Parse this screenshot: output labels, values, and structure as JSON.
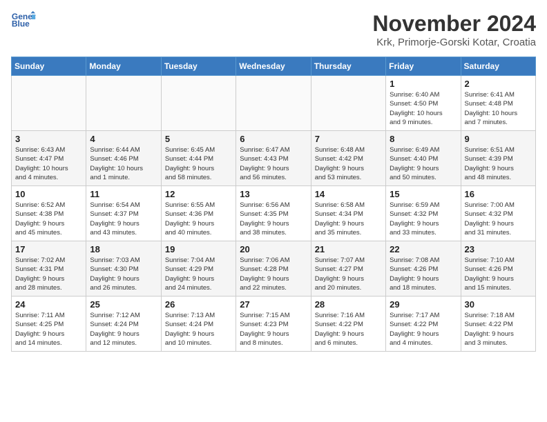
{
  "header": {
    "logo_line1": "General",
    "logo_line2": "Blue",
    "month_year": "November 2024",
    "location": "Krk, Primorje-Gorski Kotar, Croatia"
  },
  "weekdays": [
    "Sunday",
    "Monday",
    "Tuesday",
    "Wednesday",
    "Thursday",
    "Friday",
    "Saturday"
  ],
  "weeks": [
    [
      {
        "day": "",
        "info": ""
      },
      {
        "day": "",
        "info": ""
      },
      {
        "day": "",
        "info": ""
      },
      {
        "day": "",
        "info": ""
      },
      {
        "day": "",
        "info": ""
      },
      {
        "day": "1",
        "info": "Sunrise: 6:40 AM\nSunset: 4:50 PM\nDaylight: 10 hours\nand 9 minutes."
      },
      {
        "day": "2",
        "info": "Sunrise: 6:41 AM\nSunset: 4:48 PM\nDaylight: 10 hours\nand 7 minutes."
      }
    ],
    [
      {
        "day": "3",
        "info": "Sunrise: 6:43 AM\nSunset: 4:47 PM\nDaylight: 10 hours\nand 4 minutes."
      },
      {
        "day": "4",
        "info": "Sunrise: 6:44 AM\nSunset: 4:46 PM\nDaylight: 10 hours\nand 1 minute."
      },
      {
        "day": "5",
        "info": "Sunrise: 6:45 AM\nSunset: 4:44 PM\nDaylight: 9 hours\nand 58 minutes."
      },
      {
        "day": "6",
        "info": "Sunrise: 6:47 AM\nSunset: 4:43 PM\nDaylight: 9 hours\nand 56 minutes."
      },
      {
        "day": "7",
        "info": "Sunrise: 6:48 AM\nSunset: 4:42 PM\nDaylight: 9 hours\nand 53 minutes."
      },
      {
        "day": "8",
        "info": "Sunrise: 6:49 AM\nSunset: 4:40 PM\nDaylight: 9 hours\nand 50 minutes."
      },
      {
        "day": "9",
        "info": "Sunrise: 6:51 AM\nSunset: 4:39 PM\nDaylight: 9 hours\nand 48 minutes."
      }
    ],
    [
      {
        "day": "10",
        "info": "Sunrise: 6:52 AM\nSunset: 4:38 PM\nDaylight: 9 hours\nand 45 minutes."
      },
      {
        "day": "11",
        "info": "Sunrise: 6:54 AM\nSunset: 4:37 PM\nDaylight: 9 hours\nand 43 minutes."
      },
      {
        "day": "12",
        "info": "Sunrise: 6:55 AM\nSunset: 4:36 PM\nDaylight: 9 hours\nand 40 minutes."
      },
      {
        "day": "13",
        "info": "Sunrise: 6:56 AM\nSunset: 4:35 PM\nDaylight: 9 hours\nand 38 minutes."
      },
      {
        "day": "14",
        "info": "Sunrise: 6:58 AM\nSunset: 4:34 PM\nDaylight: 9 hours\nand 35 minutes."
      },
      {
        "day": "15",
        "info": "Sunrise: 6:59 AM\nSunset: 4:32 PM\nDaylight: 9 hours\nand 33 minutes."
      },
      {
        "day": "16",
        "info": "Sunrise: 7:00 AM\nSunset: 4:32 PM\nDaylight: 9 hours\nand 31 minutes."
      }
    ],
    [
      {
        "day": "17",
        "info": "Sunrise: 7:02 AM\nSunset: 4:31 PM\nDaylight: 9 hours\nand 28 minutes."
      },
      {
        "day": "18",
        "info": "Sunrise: 7:03 AM\nSunset: 4:30 PM\nDaylight: 9 hours\nand 26 minutes."
      },
      {
        "day": "19",
        "info": "Sunrise: 7:04 AM\nSunset: 4:29 PM\nDaylight: 9 hours\nand 24 minutes."
      },
      {
        "day": "20",
        "info": "Sunrise: 7:06 AM\nSunset: 4:28 PM\nDaylight: 9 hours\nand 22 minutes."
      },
      {
        "day": "21",
        "info": "Sunrise: 7:07 AM\nSunset: 4:27 PM\nDaylight: 9 hours\nand 20 minutes."
      },
      {
        "day": "22",
        "info": "Sunrise: 7:08 AM\nSunset: 4:26 PM\nDaylight: 9 hours\nand 18 minutes."
      },
      {
        "day": "23",
        "info": "Sunrise: 7:10 AM\nSunset: 4:26 PM\nDaylight: 9 hours\nand 15 minutes."
      }
    ],
    [
      {
        "day": "24",
        "info": "Sunrise: 7:11 AM\nSunset: 4:25 PM\nDaylight: 9 hours\nand 14 minutes."
      },
      {
        "day": "25",
        "info": "Sunrise: 7:12 AM\nSunset: 4:24 PM\nDaylight: 9 hours\nand 12 minutes."
      },
      {
        "day": "26",
        "info": "Sunrise: 7:13 AM\nSunset: 4:24 PM\nDaylight: 9 hours\nand 10 minutes."
      },
      {
        "day": "27",
        "info": "Sunrise: 7:15 AM\nSunset: 4:23 PM\nDaylight: 9 hours\nand 8 minutes."
      },
      {
        "day": "28",
        "info": "Sunrise: 7:16 AM\nSunset: 4:22 PM\nDaylight: 9 hours\nand 6 minutes."
      },
      {
        "day": "29",
        "info": "Sunrise: 7:17 AM\nSunset: 4:22 PM\nDaylight: 9 hours\nand 4 minutes."
      },
      {
        "day": "30",
        "info": "Sunrise: 7:18 AM\nSunset: 4:22 PM\nDaylight: 9 hours\nand 3 minutes."
      }
    ]
  ]
}
